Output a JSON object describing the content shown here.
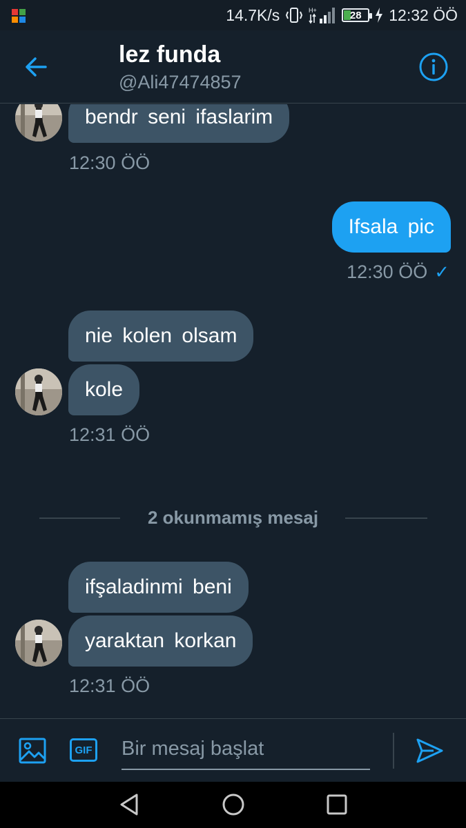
{
  "status_bar": {
    "speed": "14.7K/s",
    "battery_level": "28",
    "time": "12:32 ÖÖ",
    "icons": [
      "app-icon",
      "vibrate-icon",
      "signal-icon",
      "battery-icon",
      "charging-icon"
    ]
  },
  "header": {
    "title": "lez funda",
    "handle": "@Ali47474857"
  },
  "messages": {
    "m1": {
      "text": "bendr  seni  ifaslarim"
    },
    "t1": "12:30 ÖÖ",
    "m2": {
      "text": "Ifsala pic"
    },
    "t2": "12:30 ÖÖ",
    "t2_check": "✓",
    "m3": {
      "text": "nie  kolen  olsam"
    },
    "m4": {
      "text": "kole"
    },
    "t3": "12:31 ÖÖ",
    "divider": "2 okunmamış mesaj",
    "m5": {
      "text": "ifşaladinmi  beni"
    },
    "m6": {
      "text": "yaraktan  korkan"
    },
    "t4": "12:31 ÖÖ"
  },
  "composer": {
    "placeholder": "Bir mesaj başlat",
    "gif_label": "GIF"
  },
  "colors": {
    "background": "#15202b",
    "accent": "#1da1f2",
    "incoming_bubble": "#3d5466",
    "muted_text": "#8899a6"
  }
}
